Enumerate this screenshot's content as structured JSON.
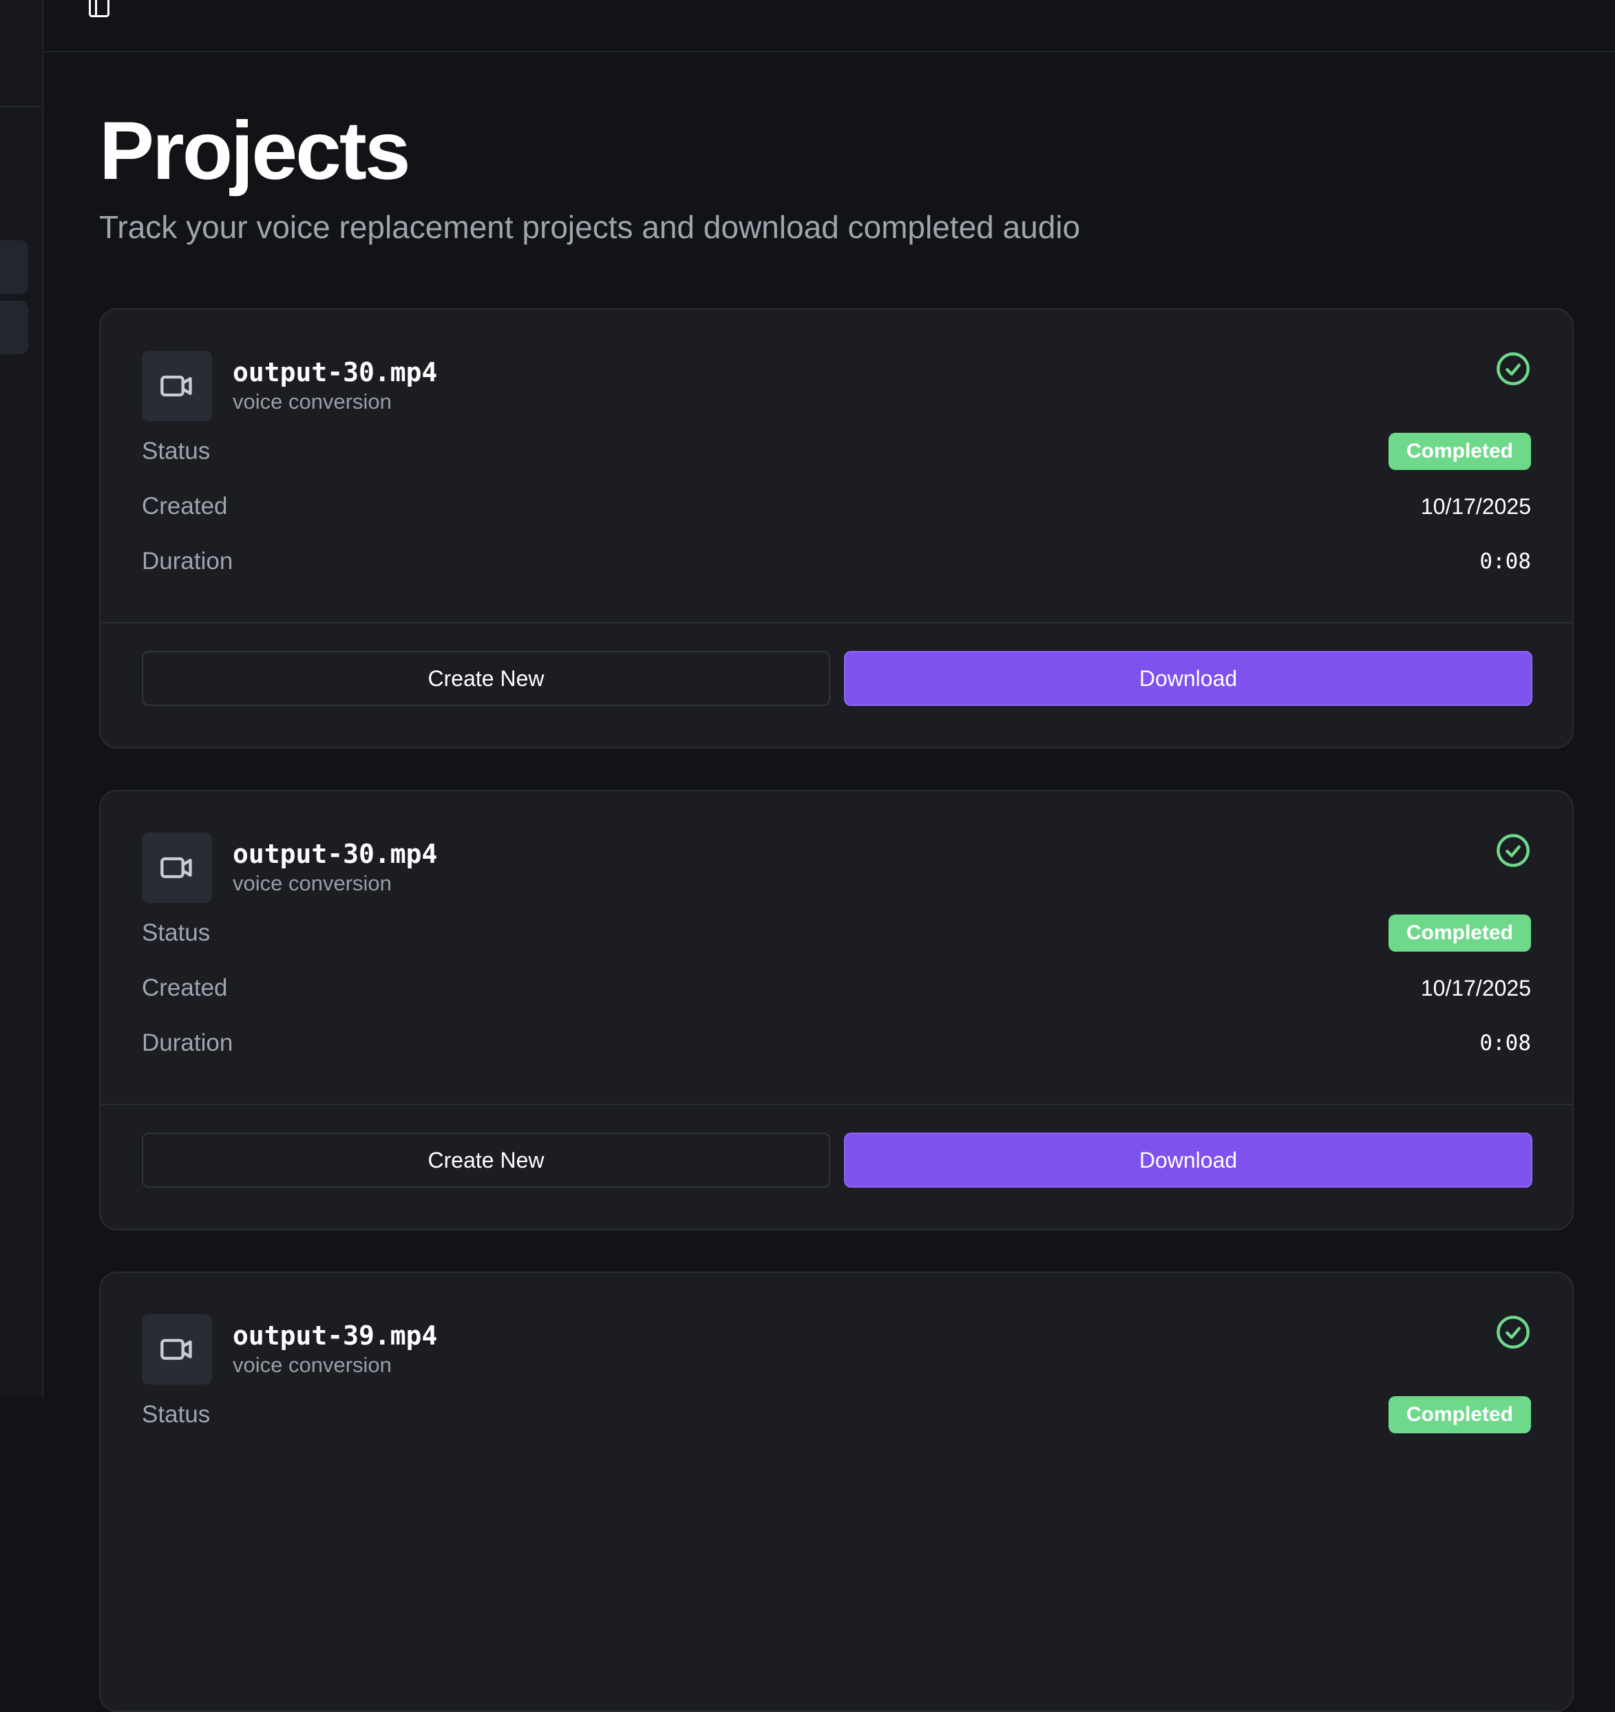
{
  "page": {
    "title": "Projects",
    "subtitle": "Track your voice replacement projects and download completed audio"
  },
  "colors": {
    "background": "#121317",
    "card": "#1c1d22",
    "accent": "#7f52ee",
    "success": "#6fd98b"
  },
  "labels": {
    "status": "Status",
    "created": "Created",
    "duration": "Duration",
    "create_new": "Create New",
    "download": "Download"
  },
  "projects": [
    {
      "file_name": "output-30.mp4",
      "type": "voice conversion",
      "status": "Completed",
      "created": "10/17/2025",
      "duration": "0:08",
      "icon": "video-camera-icon",
      "status_icon": "check-circle-icon"
    },
    {
      "file_name": "output-30.mp4",
      "type": "voice conversion",
      "status": "Completed",
      "created": "10/17/2025",
      "duration": "0:08",
      "icon": "video-camera-icon",
      "status_icon": "check-circle-icon"
    },
    {
      "file_name": "output-39.mp4",
      "type": "voice conversion",
      "status": "Completed",
      "created": "",
      "duration": "",
      "icon": "video-camera-icon",
      "status_icon": "check-circle-icon"
    }
  ]
}
